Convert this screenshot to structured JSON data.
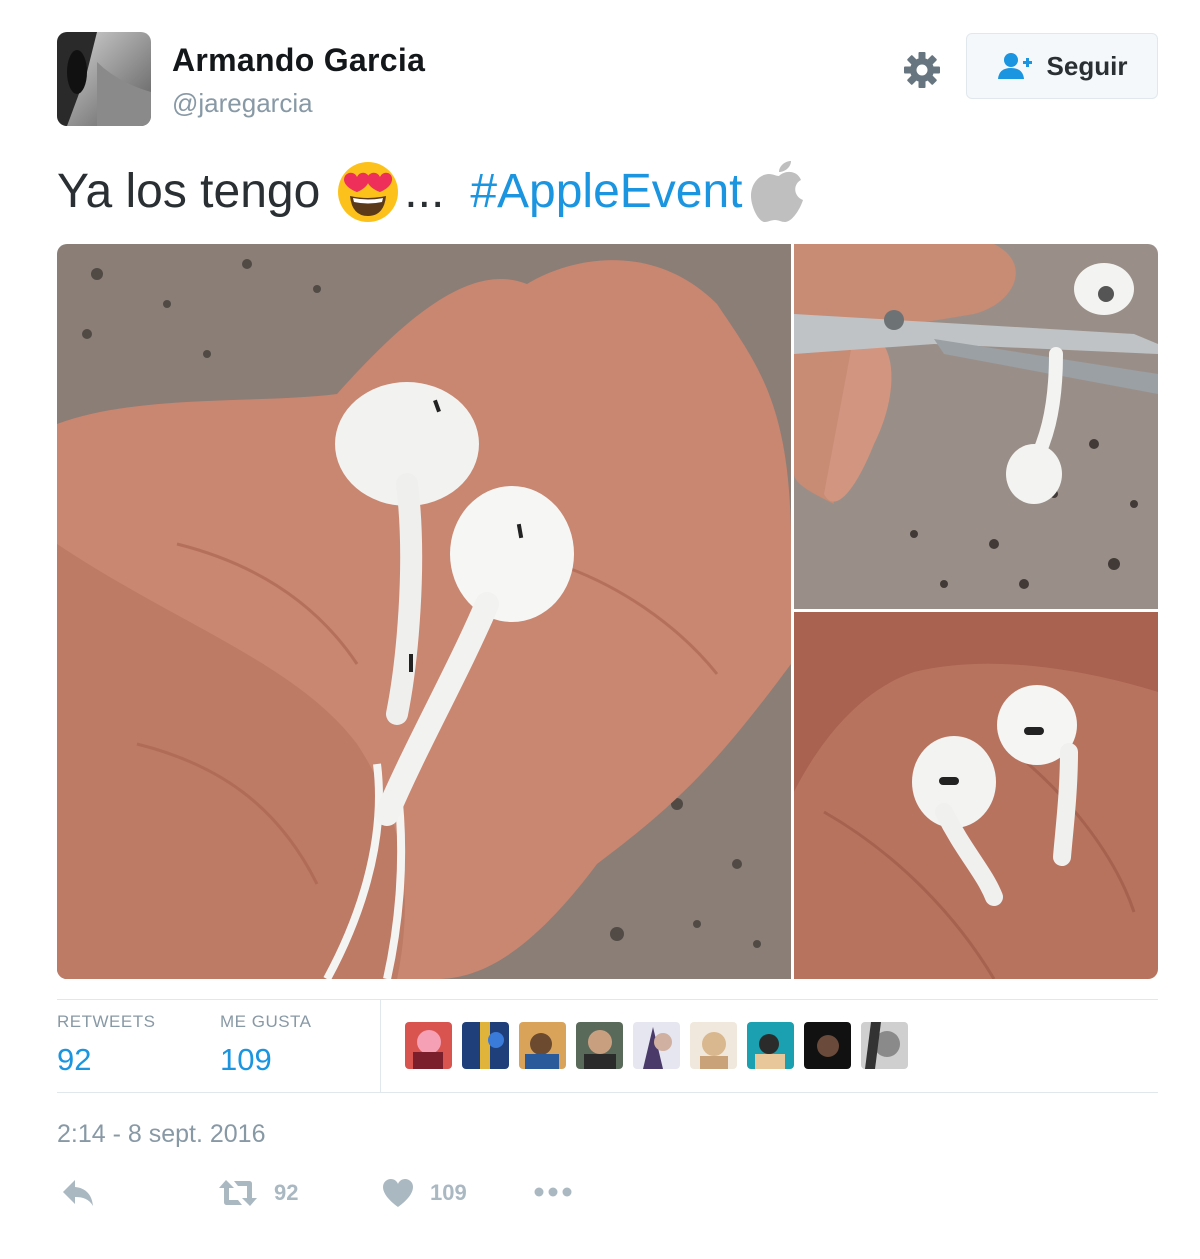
{
  "tweet": {
    "author": {
      "name": "Armando Garcia",
      "handle": "@jaregarcia"
    },
    "follow_label": "Seguir",
    "text": {
      "before": "Ya los tengo",
      "after_emoji": "...",
      "hashtag": "#AppleEvent"
    },
    "stats": {
      "retweets_label": "RETWEETS",
      "retweets": "92",
      "likes_label": "ME GUSTA",
      "likes": "109"
    },
    "liker_count": 9,
    "timestamp": "2:14 - 8 sept. 2016",
    "actions": {
      "retweet_count": "92",
      "like_count": "109"
    }
  },
  "colors": {
    "link": "#1b95e0",
    "muted": "#8899a6",
    "icon": "#aab8c2"
  },
  "icons": [
    "settings-gear-icon",
    "follow-user-icon",
    "heart-eyes-emoji",
    "apple-logo-icon",
    "reply-icon",
    "retweet-icon",
    "heart-icon",
    "more-icon"
  ]
}
